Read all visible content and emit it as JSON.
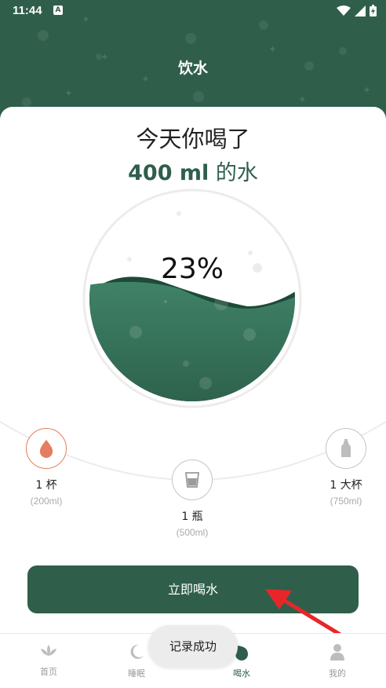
{
  "status_bar": {
    "time": "11:44",
    "notification_badge": "A"
  },
  "header": {
    "title": "饮水"
  },
  "summary": {
    "headline": "今天你喝了",
    "amount": "400 ml",
    "amount_suffix": " 的水"
  },
  "gauge": {
    "percent_label": "23%",
    "fill_fraction": 0.23
  },
  "cups": [
    {
      "label": "1 杯",
      "volume": "(200ml)",
      "icon": "water-drop-icon",
      "selected": true
    },
    {
      "label": "1 瓶",
      "volume": "(500ml)",
      "icon": "glass-icon",
      "selected": false
    },
    {
      "label": "1 大杯",
      "volume": "(750ml)",
      "icon": "bottle-icon",
      "selected": false
    }
  ],
  "action_button": {
    "label": "立即喝水"
  },
  "toast": {
    "message": "记录成功"
  },
  "tabs": [
    {
      "label": "首页",
      "icon": "lotus-icon",
      "active": false
    },
    {
      "label": "睡眠",
      "icon": "moon-icon",
      "active": false
    },
    {
      "label": "喝水",
      "icon": "water-drop-icon",
      "active": true
    },
    {
      "label": "我的",
      "icon": "user-icon",
      "active": false
    }
  ],
  "colors": {
    "brand_green": "#2f5e4b",
    "accent_orange": "#e57d5e",
    "annotation_red": "#e8262a"
  }
}
